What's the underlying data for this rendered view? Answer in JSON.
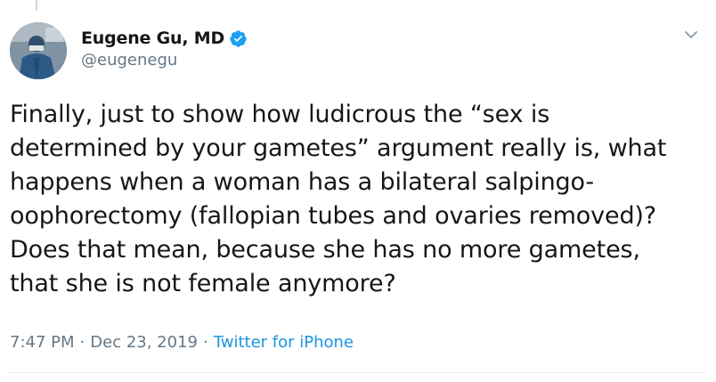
{
  "author": {
    "display_name": "Eugene Gu, MD",
    "handle": "@eugenegu",
    "verified": true,
    "avatar_icon": "profile-photo-surgeon-icon"
  },
  "tweet": {
    "lines": [
      "Finally, just to show how ludicrous the “sex is",
      "determined by your gametes” argument really is, what",
      "happens when a woman has a bilateral salpingo-",
      "oophorectomy (fallopian tubes and ovaries removed)?",
      "Does that mean, because she has no more gametes,",
      "that she is not female anymore?"
    ]
  },
  "meta": {
    "time": "7:47 PM",
    "separator": "·",
    "date": "Dec 23, 2019",
    "source": "Twitter for iPhone"
  },
  "colors": {
    "text": "#14171a",
    "secondary": "#657786",
    "link": "#1b95e0",
    "verified_badge": "#1da1f2"
  },
  "icons": {
    "more": "chevron-down-icon",
    "verified": "verified-badge-icon"
  }
}
